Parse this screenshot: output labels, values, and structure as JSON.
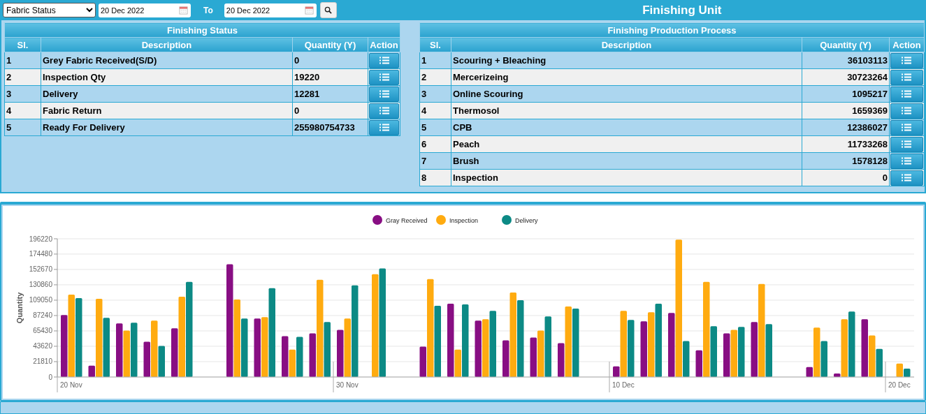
{
  "toolbar": {
    "report_select": {
      "value": "Fabric Status"
    },
    "from_date": {
      "value": "20 Dec 2022"
    },
    "to_label": "To",
    "to_date": {
      "value": "20 Dec 2022"
    }
  },
  "title": "Finishing Unit",
  "finishing_status": {
    "title": "Finishing Status",
    "columns": [
      "Sl.",
      "Description",
      "Quantity (Y)",
      "Action"
    ],
    "rows": [
      {
        "sl": "1",
        "description": "Grey Fabric Received(S/D)",
        "quantity": "0"
      },
      {
        "sl": "2",
        "description": "Inspection Qty",
        "quantity": "19220"
      },
      {
        "sl": "3",
        "description": "Delivery",
        "quantity": "12281"
      },
      {
        "sl": "4",
        "description": "Fabric Return",
        "quantity": "0"
      },
      {
        "sl": "5",
        "description": "Ready For Delivery",
        "quantity": "255980754733"
      }
    ]
  },
  "production_process": {
    "title": "Finishing Production Process",
    "columns": [
      "Sl.",
      "Description",
      "Quantity (Y)",
      "Action"
    ],
    "rows": [
      {
        "sl": "1",
        "description": "Scouring + Bleaching",
        "quantity": "36103113"
      },
      {
        "sl": "2",
        "description": "Mercerizeing",
        "quantity": "30723264"
      },
      {
        "sl": "3",
        "description": "Online Scouring",
        "quantity": "1095217"
      },
      {
        "sl": "4",
        "description": "Thermosol",
        "quantity": "1659369"
      },
      {
        "sl": "5",
        "description": "CPB",
        "quantity": "12386027"
      },
      {
        "sl": "6",
        "description": "Peach",
        "quantity": "11733268"
      },
      {
        "sl": "7",
        "description": "Brush",
        "quantity": "1578128"
      },
      {
        "sl": "8",
        "description": "Inspection",
        "quantity": "0"
      }
    ]
  },
  "chart": {
    "chart_data": {
      "type": "bar",
      "ylabel": "Quantity",
      "categories": [
        "20 Nov",
        null,
        null,
        null,
        null,
        null,
        null,
        null,
        null,
        null,
        "30 Nov",
        null,
        null,
        null,
        null,
        null,
        null,
        null,
        null,
        null,
        "10 Dec",
        null,
        null,
        null,
        null,
        null,
        null,
        null,
        null,
        null,
        "20 Dec"
      ],
      "stacked": false,
      "grid": true,
      "legend": "top",
      "ylim": [
        0,
        196220
      ],
      "yticks": [
        0,
        21810,
        43620,
        65430,
        87240,
        109050,
        130860,
        152670,
        174480,
        196220
      ],
      "series": [
        {
          "name": "Gray Received",
          "color": "#880e83",
          "values": [
            88000,
            16000,
            76000,
            50000,
            69000,
            null,
            160000,
            83000,
            58000,
            62000,
            67000,
            null,
            null,
            43000,
            104000,
            80000,
            52000,
            56000,
            48000,
            null,
            15000,
            79000,
            91000,
            38000,
            62000,
            78000,
            null,
            14000,
            5000,
            82000,
            null
          ]
        },
        {
          "name": "Inspection",
          "color": "#ffab10",
          "values": [
            117000,
            111000,
            66000,
            80000,
            114000,
            null,
            110000,
            85000,
            39000,
            138000,
            83000,
            146000,
            null,
            139000,
            39000,
            82000,
            120000,
            66000,
            100000,
            null,
            94000,
            92000,
            195000,
            135000,
            67000,
            132000,
            null,
            70000,
            82000,
            59000,
            19000
          ]
        },
        {
          "name": "Delivery",
          "color": "#0c8a85",
          "values": [
            112000,
            84000,
            77000,
            44000,
            135000,
            null,
            83000,
            126000,
            57000,
            78000,
            130000,
            154000,
            null,
            101000,
            103000,
            94000,
            109000,
            86000,
            97000,
            null,
            81000,
            104000,
            51000,
            72000,
            71000,
            75000,
            null,
            51000,
            93000,
            40000,
            12000
          ]
        }
      ]
    }
  }
}
